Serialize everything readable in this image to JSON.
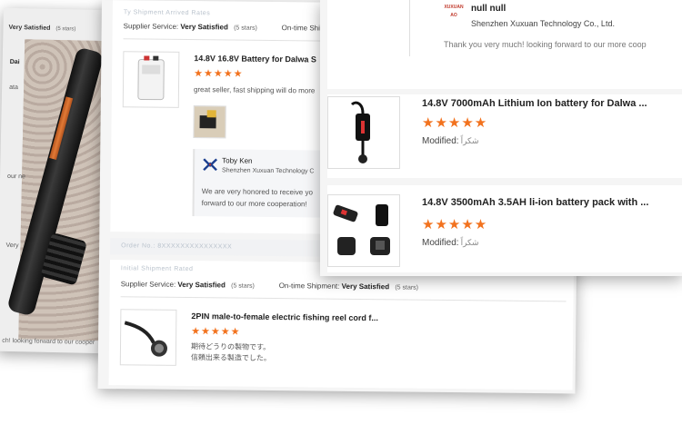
{
  "back_card": {
    "service_label": "Very Satisfied",
    "service_stars": "(5 stars)",
    "line_1": "Dai",
    "line_2": "ata",
    "line_3": "our ne",
    "line_4": "Very",
    "footer": "ch! looking forward to our cooper"
  },
  "middle_card": {
    "top_blurred": "Ty Shipment Arrived Rates",
    "review_1": {
      "supplier_service_label": "Supplier Service:",
      "supplier_service_value": "Very Satisfied",
      "supplier_service_stars": "(5 stars)",
      "ontime_label": "On-time Shipm",
      "product_title": "14.8V 16.8V Battery for Dalwa S",
      "stars": "★★★★★",
      "review_text": "great seller, fast shipping will do more",
      "reply": {
        "name": "Toby Ken",
        "company": "Shenzhen Xuxuan Technology C",
        "message_line_1": "We are very honored to receive yo",
        "message_line_2": "forward to our more cooperation!"
      }
    },
    "review_2": {
      "blurred_header": "Order No.: 8XXXXXXXXXXXXXXX",
      "blurred_sub": "Initial Shipment Rated",
      "supplier_service_label": "Supplier Service:",
      "supplier_service_value": "Very Satisfied",
      "supplier_service_stars": "(5 stars)",
      "ontime_label": "On-time Shipment:",
      "ontime_value": "Very Satisfied",
      "ontime_stars": "(5 stars)",
      "product_title": "2PIN male-to-female electric fishing reel cord f...",
      "stars": "★★★★★",
      "review_line_1": "期待どうりの製物です。",
      "review_line_2": "信頼出来る製造でした。"
    }
  },
  "front_card": {
    "reply_logo_text_1": "XUXUAN",
    "reply_logo_text_2": "AO",
    "reply_name": "null null",
    "reply_company": "Shenzhen Xuxuan Technology Co., Ltd.",
    "reply_message": "Thank you very much! looking forward to our more coop",
    "products": [
      {
        "title": "14.8V 7000mAh Lithium Ion battery for Dalwa ...",
        "stars": "★★★★★",
        "modified_label": "Modified:",
        "modified_value": "شكراً"
      },
      {
        "title": "14.8V 3500mAh 3.5AH li-ion battery pack with ...",
        "stars": "★★★★★",
        "modified_label": "Modified:",
        "modified_value": "شكراً"
      }
    ]
  },
  "colors": {
    "star": "#f2721e",
    "brand_red": "#c0392b"
  }
}
